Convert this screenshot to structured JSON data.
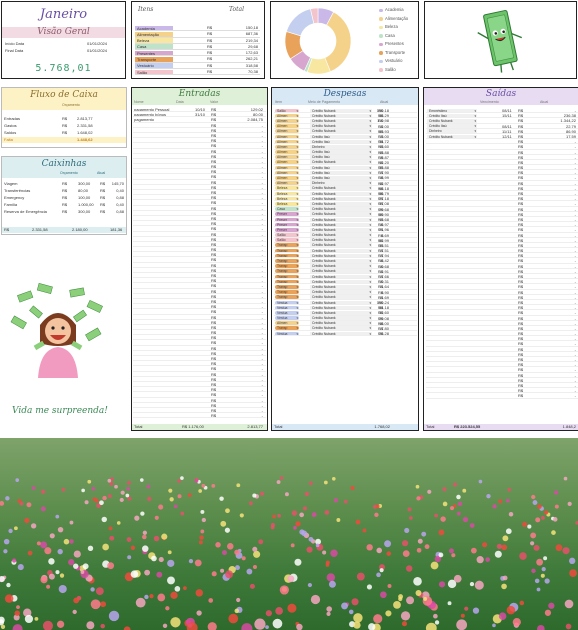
{
  "summary": {
    "month": "Janeiro",
    "subtitle": "Visão Geral",
    "start_label": "Início Data",
    "start_date": "01/01/2024",
    "end_label": "Final Data",
    "end_date": "01/01/2024",
    "balance": "5.768,01"
  },
  "items": {
    "col1": "Itens",
    "col2": "Total",
    "currency": "R$",
    "rows": [
      {
        "label": "Academia",
        "value": "150,18",
        "color": "#c9b8e8"
      },
      {
        "label": "Alimentação",
        "value": "687,36",
        "color": "#f5d28a"
      },
      {
        "label": "Beleza",
        "value": "219,34",
        "color": "#f7e7a0"
      },
      {
        "label": "Casa",
        "value": "29,68",
        "color": "#bfe3c8"
      },
      {
        "label": "Presentes",
        "value": "172,63",
        "color": "#d7a6cf"
      },
      {
        "label": "Transporte",
        "value": "262,21",
        "color": "#e8a25a"
      },
      {
        "label": "Vestuário",
        "value": "318,58",
        "color": "#c4cff0"
      },
      {
        "label": "Salão",
        "value": "70,38",
        "color": "#f3c4cc"
      }
    ]
  },
  "donut": {
    "legend": [
      "Academia",
      "Alimentação",
      "Beleza",
      "Casa",
      "Presentes",
      "Transporte",
      "Vestuário",
      "Salão"
    ]
  },
  "flow": {
    "title": "Fluxo de Caixa",
    "col": "Orçamento",
    "currency": "R$",
    "rows": [
      {
        "label": "Entradas",
        "value": "2.813,77"
      },
      {
        "label": "Gastos",
        "value": "2.331,58"
      },
      {
        "label": "Saldos",
        "value": "1.648,02"
      }
    ],
    "total_label": "Falta",
    "total_value": "1.448,62"
  },
  "savings": {
    "title": "Caixinhas",
    "col1": "Orçamento",
    "col2": "Atual",
    "currency": "R$",
    "rows": [
      {
        "label": "Viagem",
        "budget": "300,00",
        "actual": "145,70"
      },
      {
        "label": "Transferências",
        "budget": "80,00",
        "actual": "0,40"
      },
      {
        "label": "Emergency",
        "budget": "100,00",
        "actual": "0,88"
      },
      {
        "label": "Família",
        "budget": "1.000,00",
        "actual": "0,40"
      },
      {
        "label": "Reserva de Emergência",
        "budget": "300,00",
        "actual": "0,88"
      }
    ],
    "total_label": "R$",
    "total_budget": "2.331,58",
    "total_mid": "2.180,00",
    "total_actual": "181,36"
  },
  "quote": "Vida me surpreenda!",
  "entradas": {
    "title": "Entradas",
    "cols": [
      "Nome",
      "Data",
      "Valor"
    ],
    "currency": "R$",
    "rows": [
      {
        "name": "pagamento Pessoal",
        "date": "10/10",
        "value": "129,02"
      },
      {
        "name": "pagamento bônus",
        "date": "31/10",
        "value": "80,00"
      },
      {
        "name": "pagamento",
        "date": "",
        "value": "2.084,75"
      }
    ],
    "empty_rows": 57,
    "total_label": "Total",
    "total_mid": "R$ 1.176,00",
    "total_value": "2.813,77"
  },
  "despesas": {
    "title": "Despesas",
    "cols": [
      "Item",
      "Meio de Pagamento",
      "Atual"
    ],
    "currency": "R$",
    "total_label": "Total",
    "total_value": "1.768,02",
    "rows": [
      {
        "cat": "Salão",
        "pay": "Crédito Nubank",
        "value": "150,18",
        "color": "#f3c4cc"
      },
      {
        "cat": "Alimen",
        "pay": "Crédito Nubank",
        "value": "88,29",
        "color": "#f5d28a"
      },
      {
        "cat": "Alimen",
        "pay": "Crédito Nubank",
        "value": "110,98",
        "color": "#f5d28a"
      },
      {
        "cat": "Alimen",
        "pay": "Crédito Nubank",
        "value": "12,00",
        "color": "#f5d28a"
      },
      {
        "cat": "Alimen",
        "pay": "Crédito Nubank",
        "value": "83,93",
        "color": "#f5d28a"
      },
      {
        "cat": "Alimen",
        "pay": "Crédito Itaú",
        "value": "13,00",
        "color": "#f5d28a"
      },
      {
        "cat": "Alimen",
        "pay": "Crédito Itaú",
        "value": "34,72",
        "color": "#f5d28a"
      },
      {
        "cat": "Alimen",
        "pay": "Dinheiro",
        "value": "43,60",
        "color": "#f5d28a"
      },
      {
        "cat": "Alimen",
        "pay": "Crédito Itaú",
        "value": "43,88",
        "color": "#f5d28a"
      },
      {
        "cat": "Alimen",
        "pay": "Crédito Itaú",
        "value": "15,87",
        "color": "#f5d28a"
      },
      {
        "cat": "Alimen",
        "pay": "Crédito Nubank",
        "value": "42,20",
        "color": "#f5d28a"
      },
      {
        "cat": "Alimen",
        "pay": "Crédito Itaú",
        "value": "33,88",
        "color": "#f5d28a"
      },
      {
        "cat": "Alimen",
        "pay": "Crédito Itaú",
        "value": "17,90",
        "color": "#f5d28a"
      },
      {
        "cat": "Alimen",
        "pay": "Crédito Itaú",
        "value": "18,99",
        "color": "#f5d28a"
      },
      {
        "cat": "Alimen",
        "pay": "Dinheiro",
        "value": "42,97",
        "color": "#f5d28a"
      },
      {
        "cat": "Beleza",
        "pay": "Crédito Nubank",
        "value": "68,18",
        "color": "#f7e7a0"
      },
      {
        "cat": "Beleza",
        "pay": "Crédito Nubank",
        "value": "86,79",
        "color": "#f7e7a0"
      },
      {
        "cat": "Beleza",
        "pay": "Crédito Nubank",
        "value": "27,18",
        "color": "#f7e7a0"
      },
      {
        "cat": "Beleza",
        "pay": "Crédito Nubank",
        "value": "37,08",
        "color": "#f7e7a0"
      },
      {
        "cat": "Casa",
        "pay": "Crédito Nubank",
        "value": "29,68",
        "color": "#bfe3c8"
      },
      {
        "cat": "Preser",
        "pay": "Crédito Nubank",
        "value": "89,90",
        "color": "#d7a6cf"
      },
      {
        "cat": "Preser",
        "pay": "Crédito Nubank",
        "value": "43,68",
        "color": "#d7a6cf"
      },
      {
        "cat": "Preser",
        "pay": "Crédito Nubank",
        "value": "16,97",
        "color": "#d7a6cf"
      },
      {
        "cat": "Preser",
        "pay": "Crédito Nubank",
        "value": "21,96",
        "color": "#d7a6cf"
      },
      {
        "cat": "Salão",
        "pay": "Crédito Nubank",
        "value": "8,69",
        "color": "#f3c4cc"
      },
      {
        "cat": "Salão",
        "pay": "Crédito Nubank",
        "value": "82,99",
        "color": "#f3c4cc"
      },
      {
        "cat": "Transp",
        "pay": "Crédito Nubank",
        "value": "33,51",
        "color": "#e8a25a"
      },
      {
        "cat": "Transp",
        "pay": "Crédito Nubank",
        "value": "17,51",
        "color": "#e8a25a"
      },
      {
        "cat": "Transp",
        "pay": "Crédito Nubank",
        "value": "17,94",
        "color": "#e8a25a"
      },
      {
        "cat": "Transp",
        "pay": "Crédito Nubank",
        "value": "18,42",
        "color": "#e8a25a"
      },
      {
        "cat": "Transp",
        "pay": "Crédito Nubank",
        "value": "10,68",
        "color": "#e8a25a"
      },
      {
        "cat": "Transp",
        "pay": "Crédito Nubank",
        "value": "12,91",
        "color": "#e8a25a"
      },
      {
        "cat": "Transp",
        "pay": "Crédito Nubank",
        "value": "17,66",
        "color": "#e8a25a"
      },
      {
        "cat": "Transp",
        "pay": "Crédito Nubank",
        "value": "10,31",
        "color": "#e8a25a"
      },
      {
        "cat": "Transp",
        "pay": "Crédito Nubank",
        "value": "11,64",
        "color": "#e8a25a"
      },
      {
        "cat": "Transp",
        "pay": "Crédito Nubank",
        "value": "8,90",
        "color": "#e8a25a"
      },
      {
        "cat": "Transp",
        "pay": "Crédito Nubank",
        "value": "11,69",
        "color": "#e8a25a"
      },
      {
        "cat": "Vestua",
        "pay": "Crédito Nubank",
        "value": "150,24",
        "color": "#c4cff0"
      },
      {
        "cat": "Vestua",
        "pay": "Crédito Nubank",
        "value": "84,18",
        "color": "#c4cff0"
      },
      {
        "cat": "Vestua",
        "pay": "Crédito Nubank",
        "value": "32,60",
        "color": "#c4cff0"
      },
      {
        "cat": "Vestua",
        "pay": "Crédito Nubank",
        "value": "29,08",
        "color": "#c4cff0"
      },
      {
        "cat": "Alimen",
        "pay": "Crédito Nubank",
        "value": "48,00",
        "color": "#f5d28a"
      },
      {
        "cat": "Transp",
        "pay": "Crédito Nubank",
        "value": "17,80",
        "color": "#e8a25a"
      },
      {
        "cat": "Vestua",
        "pay": "Crédito Nubank",
        "value": "28,28",
        "color": "#c4cff0"
      }
    ]
  },
  "saidas": {
    "title": "Saídas",
    "cols": [
      "",
      "Vencimento",
      "Atual"
    ],
    "currency": "R$",
    "total_label": "Total",
    "total_mid": "R$ 223.524,55",
    "total_value": "1.848,2",
    "rows": [
      {
        "name": "Empréstimo",
        "due": "08/11",
        "value": "-"
      },
      {
        "name": "Crédito Itaú",
        "due": "15/11",
        "value": "236,38"
      },
      {
        "name": "Crédito Nubank",
        "due": "",
        "value": "1.344,22"
      },
      {
        "name": "Crédito Itaú",
        "due": "08/11",
        "value": "22,79"
      },
      {
        "name": "Dinheiro",
        "due": "11/11",
        "value": "86,90"
      },
      {
        "name": "Crédito Nubank",
        "due": "12/11",
        "value": "17,59"
      }
    ],
    "empty_rows": 50
  },
  "colors": {
    "purple": "#6a4ea3",
    "entradas_head": "#dff0d8",
    "despesas_head": "#d9e8f5",
    "saidas_head": "#e7dcf2",
    "flow_head": "#fdf2c6",
    "savings_head": "#dceef0",
    "total_bg": "#e7e7f2",
    "green": "#3a9b6e"
  }
}
